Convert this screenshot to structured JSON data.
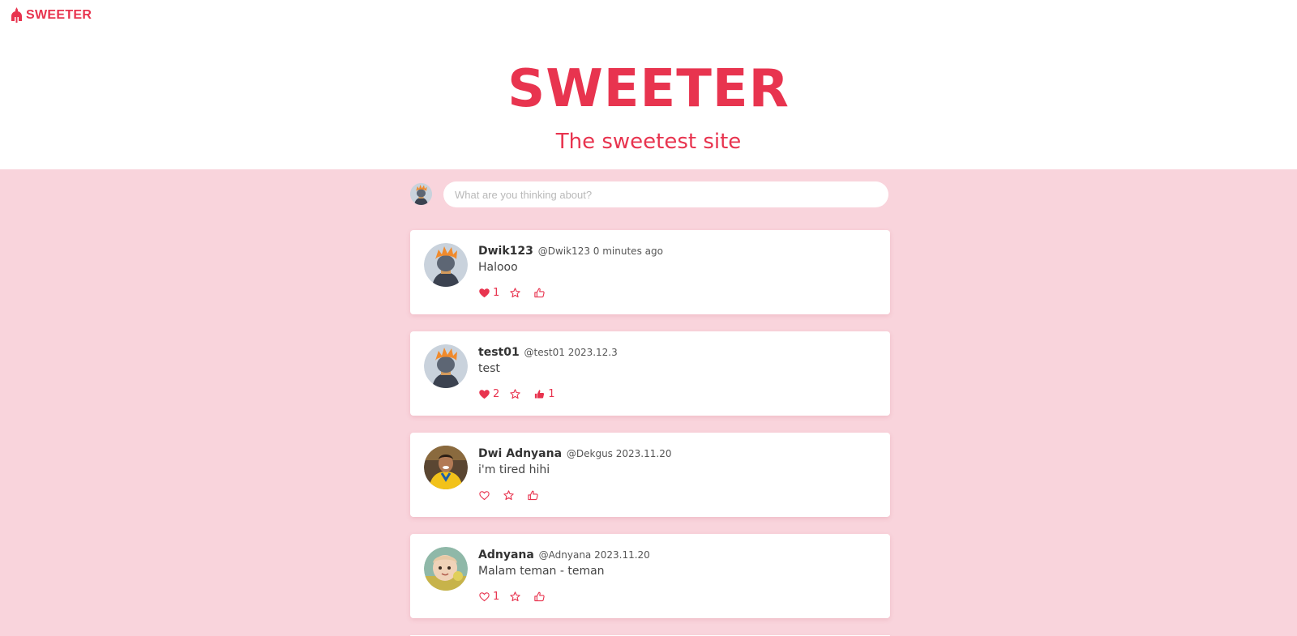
{
  "brand": {
    "name": "SWEETER"
  },
  "hero": {
    "title": "SWEETER",
    "subtitle": "The sweetest site"
  },
  "composer": {
    "placeholder": "What are you thinking about?"
  },
  "posts": [
    {
      "name": "Dwik123",
      "handle": "@Dwik123",
      "time": "0 minutes ago",
      "content": "Halooo",
      "likes": "1",
      "liked": true,
      "stars": "",
      "thumbs": "",
      "thumbed": false,
      "avatar": "orange-hair-character"
    },
    {
      "name": "test01",
      "handle": "@test01",
      "time": "2023.12.3",
      "content": "test",
      "likes": "2",
      "liked": true,
      "stars": "",
      "thumbs": "1",
      "thumbed": true,
      "avatar": "orange-hair-character"
    },
    {
      "name": "Dwi Adnyana",
      "handle": "@Dekgus",
      "time": "2023.11.20",
      "content": "i'm tired hihi",
      "likes": "",
      "liked": false,
      "stars": "",
      "thumbs": "",
      "thumbed": false,
      "avatar": "football-player-photo"
    },
    {
      "name": "Adnyana",
      "handle": "@Adnyana",
      "time": "2023.11.20",
      "content": "Malam teman - teman",
      "likes": "1",
      "liked": false,
      "stars": "",
      "thumbs": "",
      "thumbed": false,
      "avatar": "child-photo"
    }
  ],
  "colors": {
    "accent": "#e8344f",
    "feed_background": "#f9d4dc",
    "card_background": "#ffffff"
  }
}
